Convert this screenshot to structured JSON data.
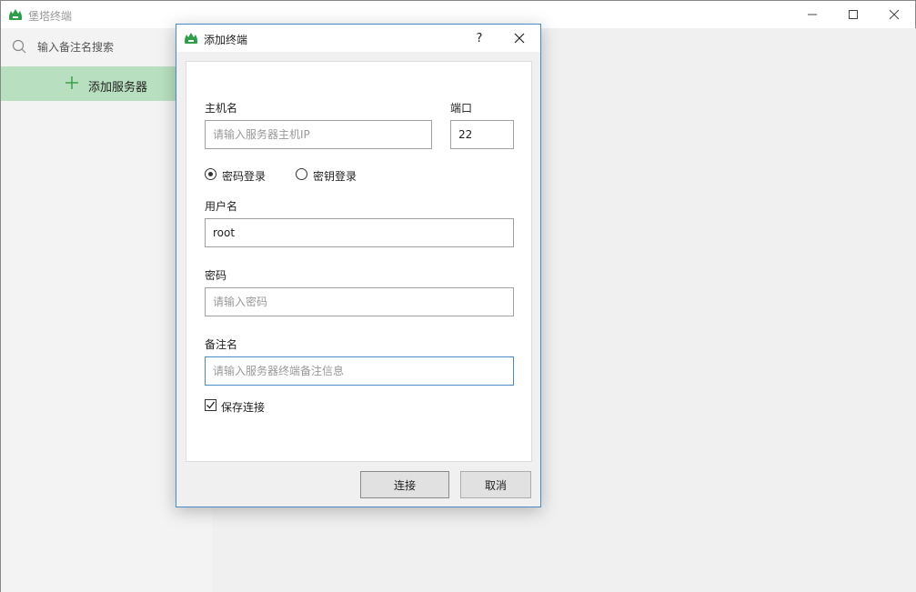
{
  "app": {
    "title": "堡塔终端",
    "window_controls": {
      "minimize": "—",
      "maximize": "☐",
      "close": "✕"
    }
  },
  "sidebar": {
    "search_placeholder": "输入备注名搜索",
    "add_server_label": "添加服务器"
  },
  "dialog": {
    "title": "添加终端",
    "help": "?",
    "close": "✕",
    "hostname_label": "主机名",
    "hostname_placeholder": "请输入服务器主机IP",
    "port_label": "端口",
    "port_value": "22",
    "auth_password_label": "密码登录",
    "auth_key_label": "密钥登录",
    "auth_selected": "password",
    "username_label": "用户名",
    "username_value": "root",
    "password_label": "密码",
    "password_placeholder": "请输入密码",
    "remark_label": "备注名",
    "remark_placeholder": "请输入服务器终端备注信息",
    "save_connection_label": "保存连接",
    "save_connection_checked": true,
    "connect_button": "连接",
    "cancel_button": "取消"
  },
  "colors": {
    "accent_green": "#b8dfbf",
    "plus_green": "#3aa04a",
    "dialog_border": "#4a8ac7"
  }
}
